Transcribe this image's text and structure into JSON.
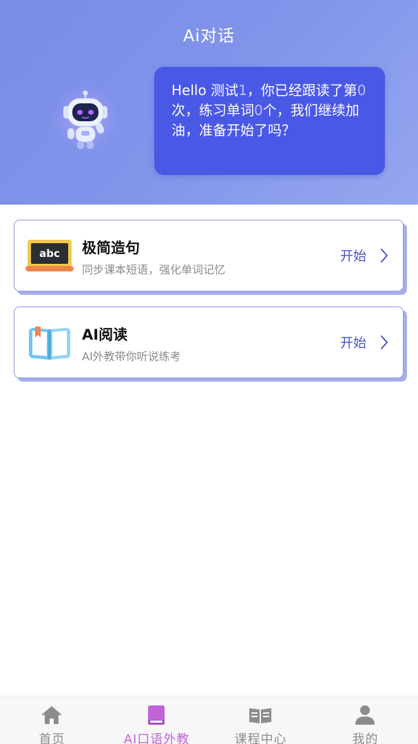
{
  "header": {
    "title": "Ai对话"
  },
  "greeting": {
    "prefix": "Hello 测试",
    "user_no": "1",
    "mid1": "，你已经跟读了第",
    "follow_count": "0",
    "mid2": "次，练习单词",
    "word_count": "0",
    "suffix": "个，我们继续加油，准备开始了吗？"
  },
  "cards": [
    {
      "title": "极简造句",
      "subtitle": "同步课本短语，强化单词记忆",
      "action": "开始",
      "icon": "abc-board-icon"
    },
    {
      "title": "AI阅读",
      "subtitle": "AI外教带你听说练考",
      "action": "开始",
      "icon": "open-book-icon"
    }
  ],
  "tabbar": {
    "items": [
      {
        "label": "首页",
        "icon": "home-icon",
        "active": false
      },
      {
        "label": "AI口语外教",
        "icon": "book-icon",
        "active": true
      },
      {
        "label": "课程中心",
        "icon": "open-book-icon",
        "active": false
      },
      {
        "label": "我的",
        "icon": "user-icon",
        "active": false
      }
    ]
  },
  "colors": {
    "header_gradient_start": "#7b8ce6",
    "header_gradient_end": "#96a7f0",
    "bubble": "#4a58e6",
    "accent_active_tab": "#c064d8",
    "card_border": "#8e98de",
    "start_text": "#4753c9"
  }
}
